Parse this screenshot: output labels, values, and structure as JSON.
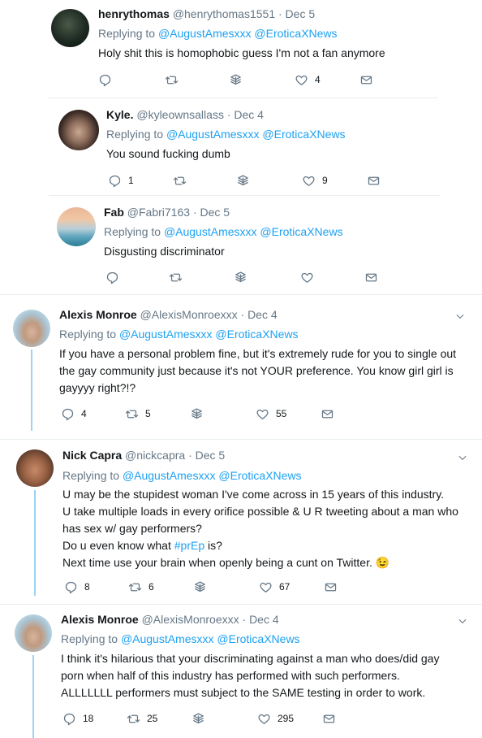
{
  "tweets": [
    {
      "name": "henrythomas",
      "handle": "@henrythomas1551",
      "date": "· Dec 5",
      "replying_prefix": "Replying to",
      "mention1": "@AugustAmesxxx",
      "mention2": "@EroticaXNews",
      "text": "Holy shit this is homophobic guess I'm not a fan  anymore",
      "replies": "",
      "retweets": "",
      "likes": "4"
    },
    {
      "name": "Kyle.",
      "handle": "@kyleownsallass",
      "date": "· Dec 4",
      "replying_prefix": "Replying to",
      "mention1": "@AugustAmesxxx",
      "mention2": "@EroticaXNews",
      "text": "You sound fucking dumb",
      "replies": "1",
      "retweets": "",
      "likes": "9"
    },
    {
      "name": "Fab",
      "handle": "@Fabri7163",
      "date": "· Dec 5",
      "replying_prefix": "Replying to",
      "mention1": "@AugustAmesxxx",
      "mention2": "@EroticaXNews",
      "text": "Disgusting discriminator",
      "replies": "",
      "retweets": "",
      "likes": ""
    },
    {
      "name": "Alexis Monroe",
      "handle": "@AlexisMonroexxx",
      "date": "· Dec 4",
      "replying_prefix": "Replying to",
      "mention1": "@AugustAmesxxx",
      "mention2": "@EroticaXNews",
      "lines": [
        "If you have a personal problem fine, but it's extremely rude for you to single out",
        "the gay community just because it's not YOUR preference. You know girl girl is",
        "gayyyy right?!?"
      ],
      "replies": "4",
      "retweets": "5",
      "likes": "55"
    },
    {
      "name": "Nick Capra",
      "handle": "@nickcapra",
      "date": "· Dec 5",
      "replying_prefix": "Replying to",
      "mention1": "@AugustAmesxxx",
      "mention2": "@EroticaXNews",
      "lines": [
        "U may be the stupidest woman I've come across in 15 years of this industry.",
        "U take multiple loads in every orifice possible & U R tweeting about a man who",
        "has sex w/ gay performers?"
      ],
      "line4_prefix": "Do u even know what ",
      "hashtag": "#prEp",
      "line4_suffix": " is?",
      "line5": "Next time use your brain when openly being a cunt on Twitter.",
      "emoji": "😉",
      "replies": "8",
      "retweets": "6",
      "likes": "67"
    },
    {
      "name": "Alexis Monroe",
      "handle": "@AlexisMonroexxx",
      "date": "· Dec 4",
      "replying_prefix": "Replying to",
      "mention1": "@AugustAmesxxx",
      "mention2": "@EroticaXNews",
      "lines": [
        "I think it's hilarious that your discriminating against a man who does/did gay",
        "porn when half of this industry has performed with such performers.",
        "ALLLLLLL performers must subject to the SAME testing in order to work."
      ],
      "replies": "18",
      "retweets": "25",
      "likes": "295"
    }
  ]
}
